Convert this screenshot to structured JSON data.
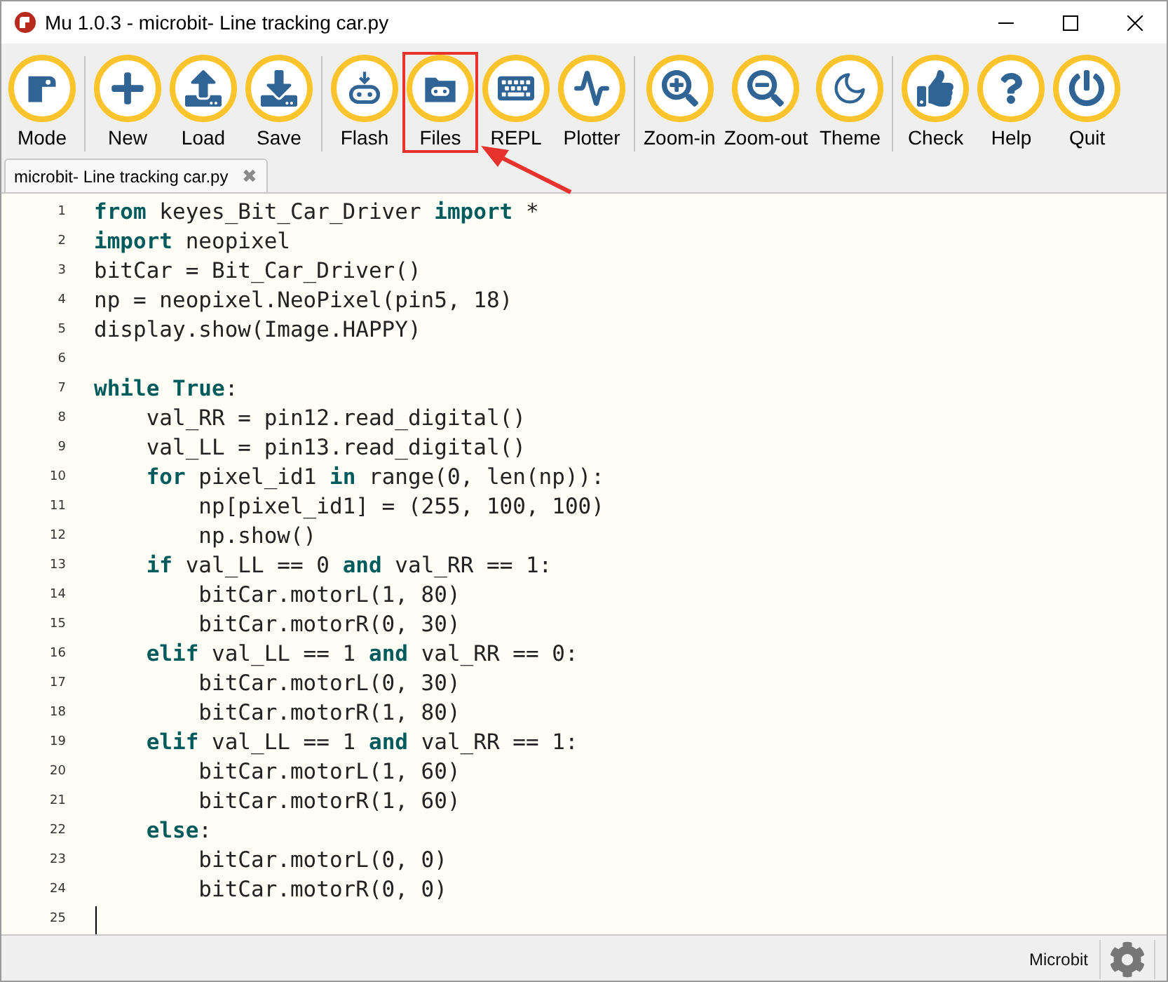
{
  "window": {
    "title": "Mu 1.0.3 - microbit- Line tracking car.py"
  },
  "toolbar": [
    [
      {
        "label": "Mode",
        "kind": "mode",
        "highlighted": false
      }
    ],
    [
      {
        "label": "New",
        "kind": "new",
        "highlighted": false
      },
      {
        "label": "Load",
        "kind": "load",
        "highlighted": false
      },
      {
        "label": "Save",
        "kind": "save",
        "highlighted": false
      }
    ],
    [
      {
        "label": "Flash",
        "kind": "flash",
        "highlighted": false
      },
      {
        "label": "Files",
        "kind": "files",
        "highlighted": true
      },
      {
        "label": "REPL",
        "kind": "repl",
        "highlighted": false
      },
      {
        "label": "Plotter",
        "kind": "plotter",
        "highlighted": false
      }
    ],
    [
      {
        "label": "Zoom-in",
        "kind": "zoomin",
        "highlighted": false
      },
      {
        "label": "Zoom-out",
        "kind": "zoomout",
        "highlighted": false
      },
      {
        "label": "Theme",
        "kind": "theme",
        "highlighted": false
      }
    ],
    [
      {
        "label": "Check",
        "kind": "check",
        "highlighted": false
      },
      {
        "label": "Help",
        "kind": "help",
        "highlighted": false
      },
      {
        "label": "Quit",
        "kind": "quit",
        "highlighted": false
      }
    ]
  ],
  "tabs": [
    {
      "label": "microbit- Line tracking car.py",
      "close": "✖",
      "selected": true
    }
  ],
  "editor": {
    "lines": [
      {
        "number": "1",
        "code": "**from** keyes_Bit_Car_Driver **import** *"
      },
      {
        "number": "2",
        "code": "**import** neopixel"
      },
      {
        "number": "3",
        "code": "bitCar = Bit_Car_Driver()"
      },
      {
        "number": "4",
        "code": "np = neopixel.NeoPixel(pin5, 18)"
      },
      {
        "number": "5",
        "code": "display.show(Image.HAPPY)"
      },
      {
        "number": "6"
      },
      {
        "number": "7",
        "code": "**while** **True**:"
      },
      {
        "number": "8",
        "code": "    val_RR = pin12.read_digital()"
      },
      {
        "number": "9",
        "code": "    val_LL = pin13.read_digital()"
      },
      {
        "number": "10",
        "code": "    **for** pixel_id1 **in** range(0, len(np)):"
      },
      {
        "number": "11",
        "code": "        np[pixel_id1] = (255, 100, 100)"
      },
      {
        "number": "12",
        "code": "        np.show()"
      },
      {
        "number": "13",
        "code": "    **if** val_LL == 0 **and** val_RR == 1:"
      },
      {
        "number": "14",
        "code": "        bitCar.motorL(1, 80)"
      },
      {
        "number": "15",
        "code": "        bitCar.motorR(0, 30)"
      },
      {
        "number": "16",
        "code": "    **elif** val_LL == 1 **and** val_RR == 0:"
      },
      {
        "number": "17",
        "code": "        bitCar.motorL(0, 30)"
      },
      {
        "number": "18",
        "code": "        bitCar.motorR(1, 80)"
      },
      {
        "number": "19",
        "code": "    **elif** val_LL == 1 **and** val_RR == 1:"
      },
      {
        "number": "20",
        "code": "        bitCar.motorL(1, 60)"
      },
      {
        "number": "21",
        "code": "        bitCar.motorR(1, 60)"
      },
      {
        "number": "22",
        "code": "    **else**:"
      },
      {
        "number": "23",
        "code": "        bitCar.motorL(0, 0)"
      },
      {
        "number": "24",
        "code": "        bitCar.motorR(0, 0)"
      },
      {
        "number": "25"
      }
    ]
  },
  "status_bar": {
    "mode": "Microbit"
  }
}
